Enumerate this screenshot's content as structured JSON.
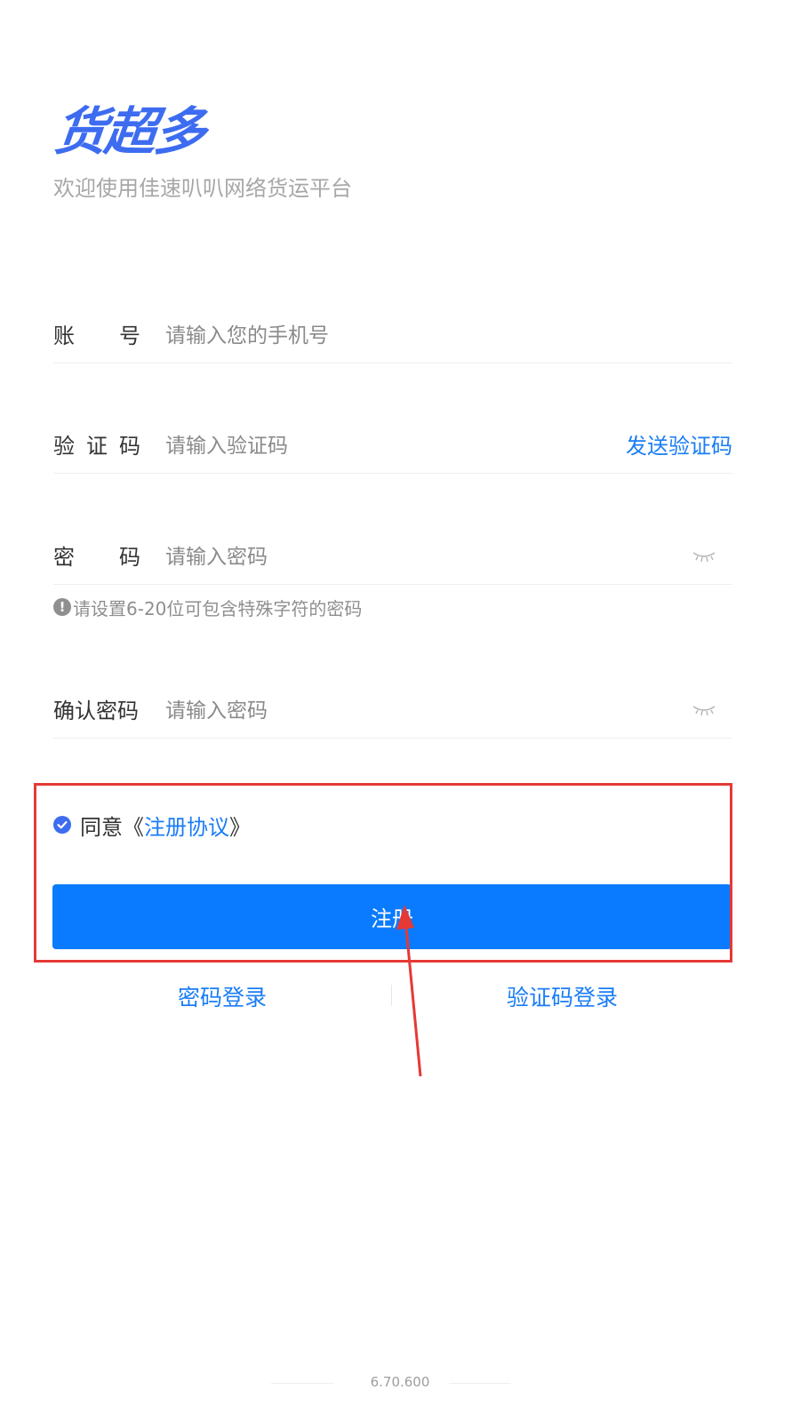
{
  "brand": {
    "logo_text": "货超多",
    "subtitle": "欢迎使用佳速叭叭网络货运平台",
    "color": "#3d6cf0"
  },
  "form": {
    "account": {
      "label_chars": [
        "账",
        "号"
      ],
      "placeholder": "请输入您的手机号"
    },
    "code": {
      "label_chars": [
        "验",
        "证",
        "码"
      ],
      "placeholder": "请输入验证码",
      "send_label": "发送验证码"
    },
    "password": {
      "label_chars": [
        "密",
        "码"
      ],
      "placeholder": "请输入密码",
      "toggle_icon": "eye-closed-icon"
    },
    "password_hint": "请设置6-20位可包含特殊字符的密码",
    "confirm": {
      "label": "确认密码",
      "placeholder": "请输入密码",
      "toggle_icon": "eye-closed-icon"
    }
  },
  "agreement": {
    "checked": true,
    "prefix": "同意《",
    "link": "注册协议",
    "suffix": "》"
  },
  "register_button": "注册",
  "links": {
    "password_login": "密码登录",
    "code_login": "验证码登录"
  },
  "version": "6.70.600",
  "colors": {
    "accent": "#1a7df5",
    "button": "#0a7bfe",
    "annotation": "#e53935"
  }
}
